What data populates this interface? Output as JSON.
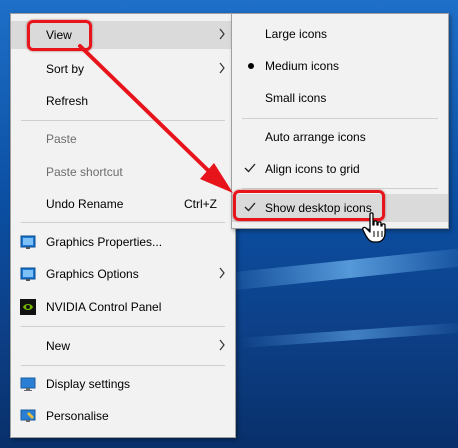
{
  "colors": {
    "menu_bg": "#f2f2f2",
    "hover_bg": "#dadada",
    "highlight_red": "#e8141b",
    "disabled_text": "#6d6d6d",
    "desktop_blue": "#0b4fa3"
  },
  "context_menu": {
    "view": "View",
    "sort_by": "Sort by",
    "refresh": "Refresh",
    "paste": "Paste",
    "paste_shortcut": "Paste shortcut",
    "undo_rename": "Undo Rename",
    "undo_rename_shortcut": "Ctrl+Z",
    "graphics_properties": "Graphics Properties...",
    "graphics_options": "Graphics Options",
    "nvidia_control_panel": "NVIDIA Control Panel",
    "new": "New",
    "display_settings": "Display settings",
    "personalise": "Personalise"
  },
  "view_submenu": {
    "large_icons": "Large icons",
    "medium_icons": "Medium icons",
    "small_icons": "Small icons",
    "auto_arrange_icons": "Auto arrange icons",
    "align_icons_to_grid": "Align icons to grid",
    "show_desktop_icons": "Show desktop icons"
  },
  "icons": {
    "graphics_properties": "intel-graphics-icon",
    "graphics_options": "intel-graphics-icon",
    "nvidia_control_panel": "nvidia-icon",
    "display_settings": "display-icon",
    "personalise": "personalise-icon"
  }
}
